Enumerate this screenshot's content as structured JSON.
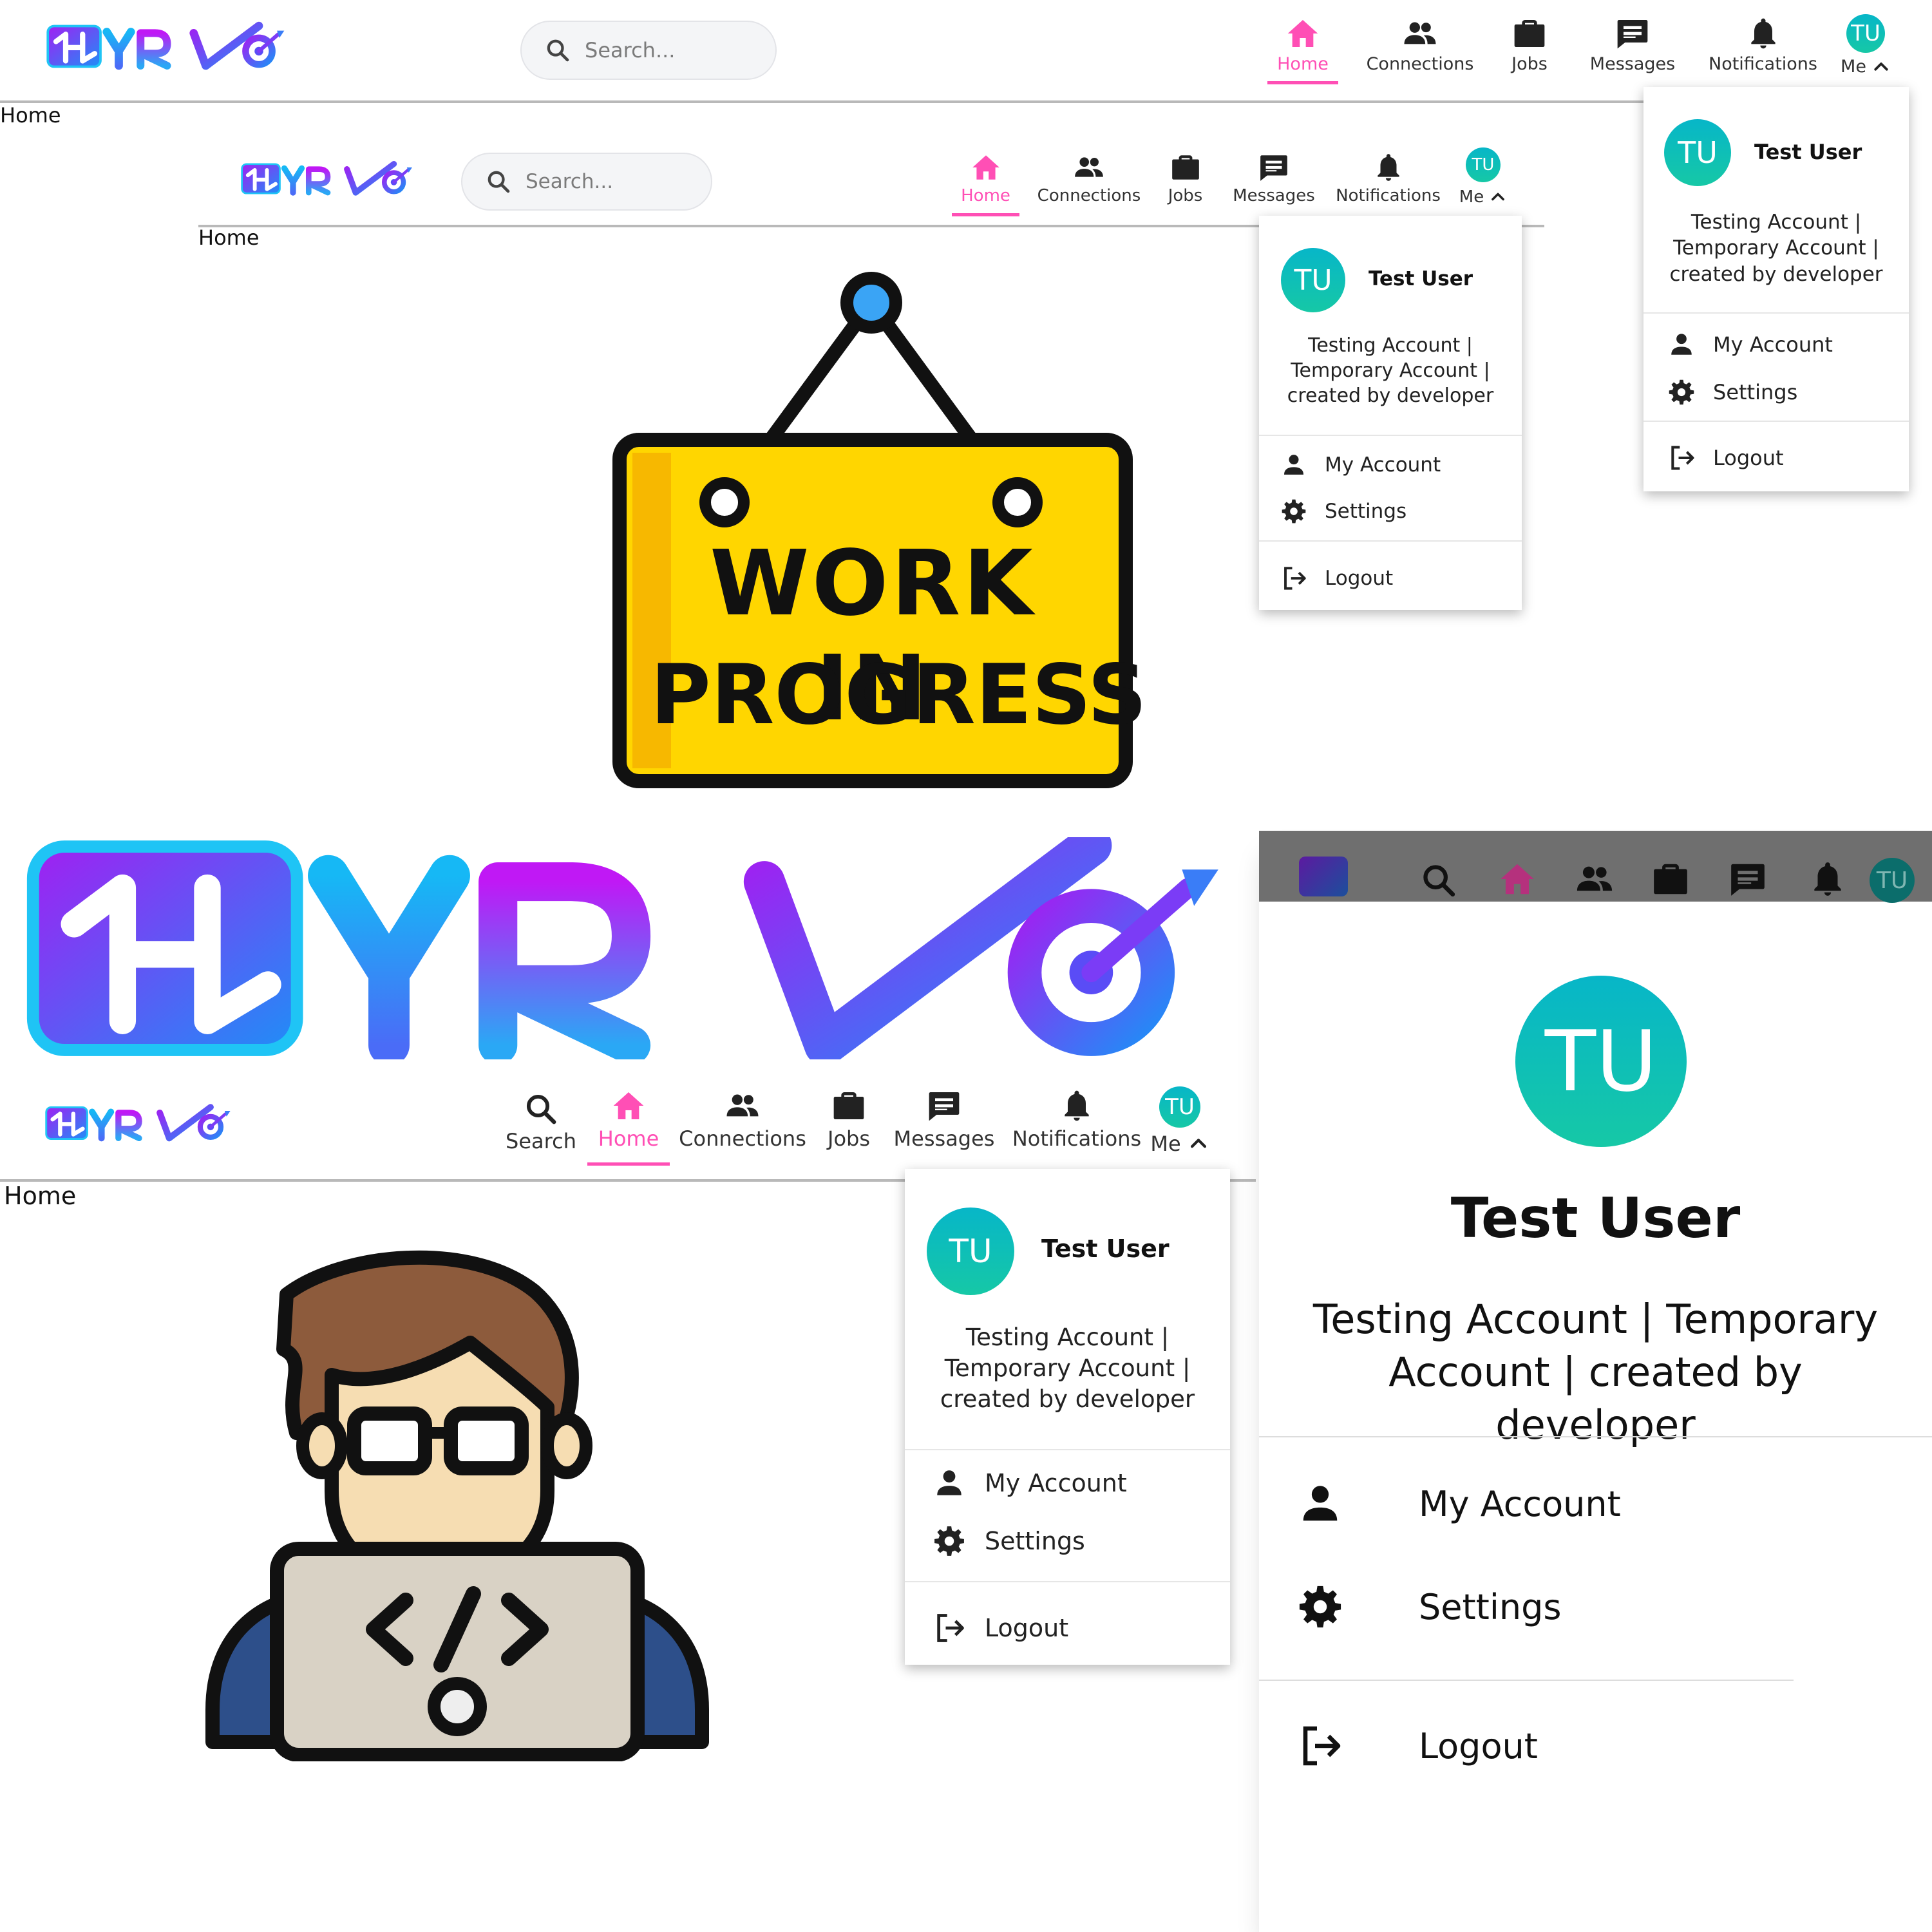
{
  "brand": {
    "logo_text": "HYRIVO"
  },
  "search": {
    "placeholder": "Search..."
  },
  "nav": {
    "home": "Home",
    "connections": "Connections",
    "jobs": "Jobs",
    "messages": "Messages",
    "notifications": "Notifications",
    "me": "Me",
    "search": "Search"
  },
  "breadcrumb": "Home",
  "user": {
    "initials": "TU",
    "name": "Test User",
    "description": "Testing Account | Temporary Account | created by developer"
  },
  "menu": {
    "my_account": "My Account",
    "settings": "Settings",
    "logout": "Logout"
  },
  "sign": {
    "line1": "WORK IN",
    "line2": "PROGRESS"
  },
  "colors": {
    "accent": "#ff4fb5",
    "avatar": "#0fbdb8",
    "sign": "#ffd600"
  }
}
